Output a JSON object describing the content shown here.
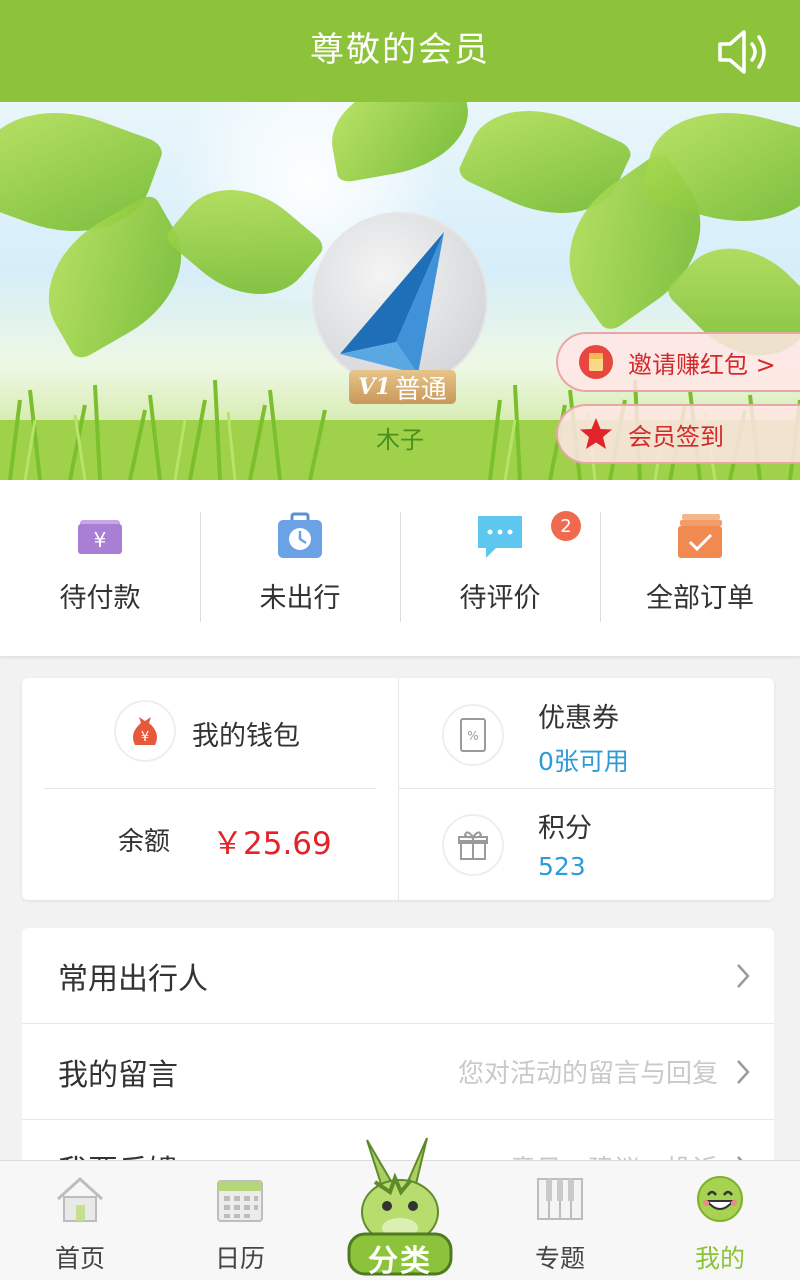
{
  "header": {
    "title": "尊敬的会员",
    "speaker_icon": "speaker-icon"
  },
  "profile": {
    "avatar_icon": "paper-plane-icon",
    "level_badge": {
      "prefix": "V1",
      "label": "普通"
    },
    "username": "木子"
  },
  "actions": {
    "invite": {
      "label": "邀请赚红包 >",
      "icon": "red-envelope-icon"
    },
    "signin": {
      "label": "会员签到",
      "icon": "star-icon"
    }
  },
  "orders": [
    {
      "label": "待付款",
      "icon": "wallet-yen-icon"
    },
    {
      "label": "未出行",
      "icon": "suitcase-clock-icon"
    },
    {
      "label": "待评价",
      "icon": "chat-bubble-icon",
      "badge": "2"
    },
    {
      "label": "全部订单",
      "icon": "order-list-icon"
    }
  ],
  "wallet": {
    "title": "我的钱包",
    "balance_label": "余额",
    "balance_value": "￥25.69",
    "coupon": {
      "title": "优惠券",
      "sub": "0张可用"
    },
    "points": {
      "title": "积分",
      "sub": "523"
    }
  },
  "menu": [
    {
      "title": "常用出行人",
      "hint": ""
    },
    {
      "title": "我的留言",
      "hint": "您对活动的留言与回复"
    },
    {
      "title": "我要反馈",
      "hint": "意见、建议、投诉"
    }
  ],
  "nav": [
    {
      "label": "首页",
      "icon": "home-icon"
    },
    {
      "label": "日历",
      "icon": "calendar-icon"
    },
    {
      "label": "分类",
      "icon": "donkey-mascot-icon"
    },
    {
      "label": "专题",
      "icon": "piano-icon"
    },
    {
      "label": "我的",
      "icon": "smiley-icon"
    }
  ],
  "colors": {
    "brand": "#8cc33b",
    "accent_red": "#e3232a",
    "link_blue": "#2e9ad6",
    "badge": "#ef6a4e"
  }
}
